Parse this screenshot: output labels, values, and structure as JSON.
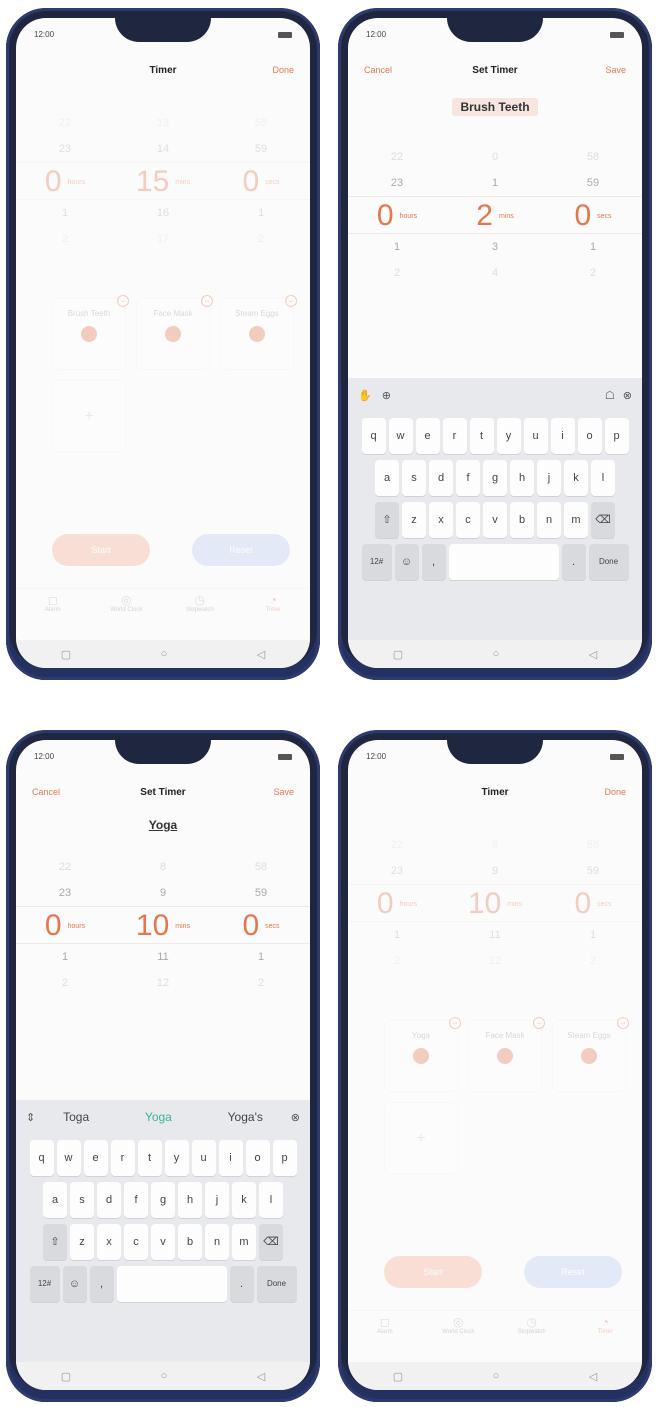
{
  "status_time": "12:00",
  "screens": {
    "timer1": {
      "title": "Timer",
      "done": "Done",
      "wheel": {
        "above2": [
          "22",
          "13",
          "58"
        ],
        "above1": [
          "23",
          "14",
          "59"
        ],
        "selected": [
          "0",
          "15",
          "0"
        ],
        "below1": [
          "1",
          "16",
          "1"
        ],
        "below2": [
          "2",
          "17",
          "2"
        ],
        "units": [
          "hours",
          "mins",
          "secs"
        ]
      },
      "presets": [
        "Brush Teeth",
        "Face Mask",
        "Steam Eggs"
      ],
      "start": "Start",
      "reset": "Reset"
    },
    "set1": {
      "cancel": "Cancel",
      "title": "Set Timer",
      "save": "Save",
      "name": "Brush Teeth",
      "wheel": {
        "above2": [
          "22",
          "0",
          "58"
        ],
        "above1": [
          "23",
          "1",
          "59"
        ],
        "selected": [
          "0",
          "2",
          "0"
        ],
        "below1": [
          "1",
          "3",
          "1"
        ],
        "below2": [
          "2",
          "4",
          "2"
        ],
        "units": [
          "hours",
          "mins",
          "secs"
        ]
      }
    },
    "set2": {
      "cancel": "Cancel",
      "title": "Set Timer",
      "save": "Save",
      "name": "Yoga",
      "suggestions": [
        "Toga",
        "Yoga",
        "Yoga's"
      ],
      "wheel": {
        "above2": [
          "22",
          "8",
          "58"
        ],
        "above1": [
          "23",
          "9",
          "59"
        ],
        "selected": [
          "0",
          "10",
          "0"
        ],
        "below1": [
          "1",
          "11",
          "1"
        ],
        "below2": [
          "2",
          "12",
          "2"
        ],
        "units": [
          "hours",
          "mins",
          "secs"
        ]
      }
    },
    "timer2": {
      "title": "Timer",
      "done": "Done",
      "wheel": {
        "above2": [
          "22",
          "8",
          "58"
        ],
        "above1": [
          "23",
          "9",
          "59"
        ],
        "selected": [
          "0",
          "10",
          "0"
        ],
        "below1": [
          "1",
          "11",
          "1"
        ],
        "below2": [
          "2",
          "12",
          "2"
        ],
        "units": [
          "hours",
          "mins",
          "secs"
        ]
      },
      "presets": [
        "Yoga",
        "Face Mask",
        "Steam Eggs"
      ],
      "start": "Start",
      "reset": "Reset"
    }
  },
  "tabs": [
    "Alarm",
    "World Clock",
    "Stopwatch",
    "Timer"
  ],
  "keyboard": {
    "row1": [
      "q",
      "w",
      "e",
      "r",
      "t",
      "y",
      "u",
      "i",
      "o",
      "p"
    ],
    "row2": [
      "a",
      "s",
      "d",
      "f",
      "g",
      "h",
      "j",
      "k",
      "l"
    ],
    "row3": [
      "z",
      "x",
      "c",
      "v",
      "b",
      "n",
      "m"
    ],
    "num": "12#",
    "done": "Done"
  },
  "colors": {
    "accent": "#e4774e",
    "reset": "#b9c8f2"
  }
}
